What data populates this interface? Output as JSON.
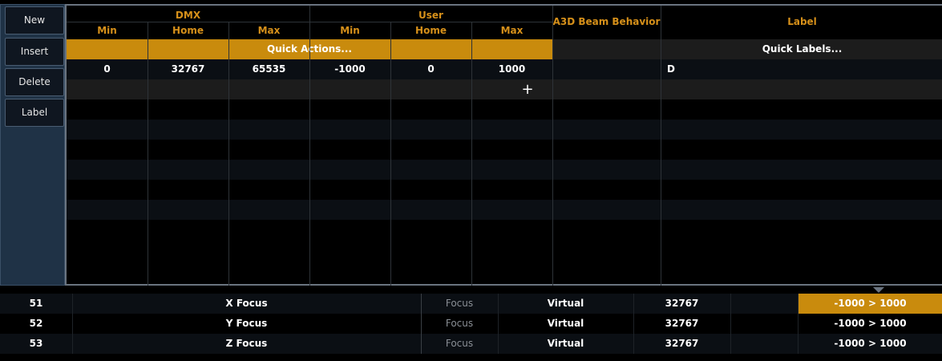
{
  "sidebar": {
    "buttons": [
      "New",
      "Insert",
      "Delete",
      "Label"
    ]
  },
  "grid": {
    "groups": {
      "dmx": "DMX",
      "user": "User",
      "beam": "A3D Beam Behavior",
      "label": "Label"
    },
    "subheaders": {
      "dmx_min": "Min",
      "dmx_home": "Home",
      "dmx_max": "Max",
      "user_min": "Min",
      "user_home": "Home",
      "user_max": "Max"
    },
    "quick_actions": "Quick Actions...",
    "quick_labels": "Quick Labels...",
    "row": {
      "dmx_min": "0",
      "dmx_home": "32767",
      "dmx_max": "65535",
      "user_min": "-1000",
      "user_home": "0",
      "user_max": "1000",
      "beam": "",
      "label": "D"
    },
    "add_symbol": "+"
  },
  "background_table": {
    "rows": [
      {
        "num": "51",
        "name": "X Focus",
        "category": "Focus",
        "mode": "Virtual",
        "home": "32767",
        "range": "-1000 > 1000",
        "selected": true
      },
      {
        "num": "52",
        "name": "Y Focus",
        "category": "Focus",
        "mode": "Virtual",
        "home": "32767",
        "range": "-1000 > 1000",
        "selected": false
      },
      {
        "num": "53",
        "name": "Z Focus",
        "category": "Focus",
        "mode": "Virtual",
        "home": "32767",
        "range": "-1000 > 1000",
        "selected": false
      }
    ]
  },
  "colors": {
    "accent": "#c98b0d",
    "header_text": "#d6901a",
    "sidebar": "#1f3246"
  }
}
